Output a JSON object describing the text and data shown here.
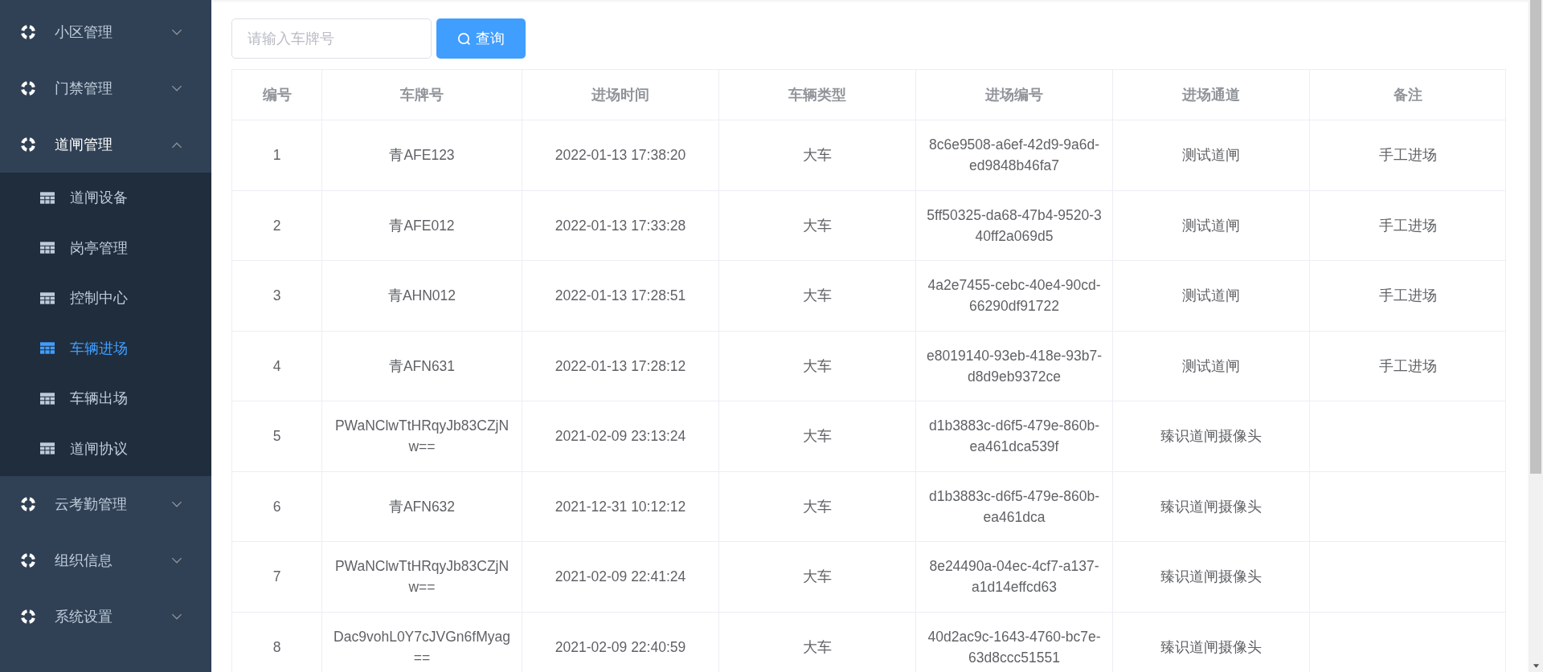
{
  "sidebar": {
    "items": [
      {
        "label": "小区管理",
        "expanded": false
      },
      {
        "label": "门禁管理",
        "expanded": false
      },
      {
        "label": "道闸管理",
        "expanded": true,
        "children": [
          {
            "label": "道闸设备",
            "selected": false
          },
          {
            "label": "岗亭管理",
            "selected": false
          },
          {
            "label": "控制中心",
            "selected": false
          },
          {
            "label": "车辆进场",
            "selected": true
          },
          {
            "label": "车辆出场",
            "selected": false
          },
          {
            "label": "道闸协议",
            "selected": false
          }
        ]
      },
      {
        "label": "云考勤管理",
        "expanded": false
      },
      {
        "label": "组织信息",
        "expanded": false
      },
      {
        "label": "系统设置",
        "expanded": false
      }
    ]
  },
  "search": {
    "placeholder": "请输入车牌号",
    "button": "查询"
  },
  "table": {
    "columns": [
      "编号",
      "车牌号",
      "进场时间",
      "车辆类型",
      "进场编号",
      "进场通道",
      "备注"
    ],
    "rows": [
      [
        "1",
        "青AFE123",
        "2022-01-13 17:38:20",
        "大车",
        "8c6e9508-a6ef-42d9-9a6d-ed9848b46fa7",
        "测试道闸",
        "手工进场"
      ],
      [
        "2",
        "青AFE012",
        "2022-01-13 17:33:28",
        "大车",
        "5ff50325-da68-47b4-9520-340ff2a069d5",
        "测试道闸",
        "手工进场"
      ],
      [
        "3",
        "青AHN012",
        "2022-01-13 17:28:51",
        "大车",
        "4a2e7455-cebc-40e4-90cd-66290df91722",
        "测试道闸",
        "手工进场"
      ],
      [
        "4",
        "青AFN631",
        "2022-01-13 17:28:12",
        "大车",
        "e8019140-93eb-418e-93b7-d8d9eb9372ce",
        "测试道闸",
        "手工进场"
      ],
      [
        "5",
        "PWaNClwTtHRqyJb83CZjNw==",
        "2021-02-09 23:13:24",
        "大车",
        "d1b3883c-d6f5-479e-860b-ea461dca539f",
        "臻识道闸摄像头",
        ""
      ],
      [
        "6",
        "青AFN632",
        "2021-12-31 10:12:12",
        "大车",
        "d1b3883c-d6f5-479e-860b-ea461dca",
        "臻识道闸摄像头",
        ""
      ],
      [
        "7",
        "PWaNClwTtHRqyJb83CZjNw==",
        "2021-02-09 22:41:24",
        "大车",
        "8e24490a-04ec-4cf7-a137-a1d14effcd63",
        "臻识道闸摄像头",
        ""
      ],
      [
        "8",
        "Dac9vohL0Y7cJVGn6fMyag==",
        "2021-02-09 22:40:59",
        "大车",
        "40d2ac9c-1643-4760-bc7e-63d8ccc51551",
        "臻识道闸摄像头",
        ""
      ]
    ]
  }
}
